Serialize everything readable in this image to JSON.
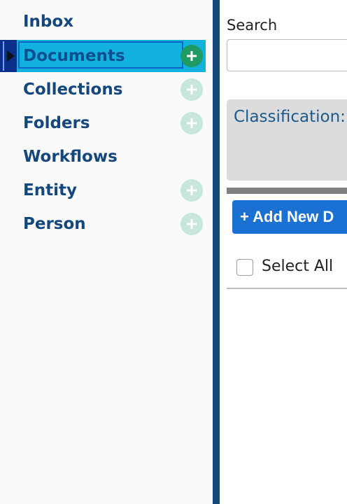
{
  "sidebar": {
    "items": [
      {
        "label": "Inbox"
      },
      {
        "label": "Documents"
      },
      {
        "label": "Collections"
      },
      {
        "label": "Folders"
      },
      {
        "label": "Workflows"
      },
      {
        "label": "Entity"
      },
      {
        "label": "Person"
      }
    ],
    "selected": "Documents"
  },
  "main": {
    "search_label": "Search",
    "search_value": "",
    "classification_label": "Classification:",
    "add_new_label": "+ Add New D",
    "select_all_label": "Select All",
    "select_all_checked": false
  },
  "colors": {
    "sidebar_text": "#14477c",
    "selected_bg": "#13b1de",
    "add_icon": "#c7e6dc",
    "add_icon_active": "#1e9a63",
    "divider": "#14497f",
    "button": "#1b71d3"
  },
  "icons": {
    "add": "plus-circle-icon",
    "selection": "caret-right-icon"
  }
}
